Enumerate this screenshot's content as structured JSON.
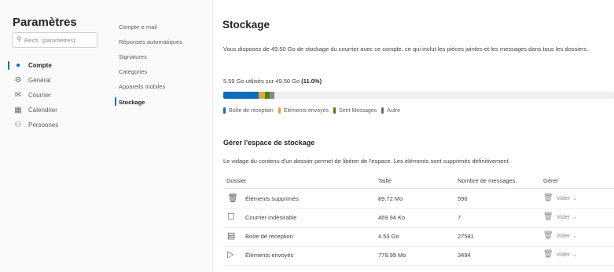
{
  "settings": {
    "title": "Paramètres",
    "search_placeholder": "Rech. (paramètres)"
  },
  "nav_primary": [
    {
      "label": "Compte",
      "icon": "person-icon",
      "active": true
    },
    {
      "label": "Général",
      "icon": "gear-icon",
      "active": false
    },
    {
      "label": "Courrier",
      "icon": "mail-icon",
      "active": false
    },
    {
      "label": "Calendrier",
      "icon": "calendar-icon",
      "active": false
    },
    {
      "label": "Personnes",
      "icon": "people-icon",
      "active": false
    }
  ],
  "nav_secondary": [
    {
      "label": "Compte e-mail",
      "active": false
    },
    {
      "label": "Réponses automatiques",
      "active": false
    },
    {
      "label": "Signatures",
      "active": false
    },
    {
      "label": "Catégories",
      "active": false
    },
    {
      "label": "Appareils mobiles",
      "active": false
    },
    {
      "label": "Stockage",
      "active": true
    }
  ],
  "main": {
    "title": "Stockage",
    "description": "Vous disposez de 49.50 Go de stockage du courrier avec ce compte, ce qui inclut les pièces jointes et les messages dans tous les dossiers.",
    "usage_text": "5.59 Go utilisés sur 49.50 Go",
    "usage_percent_text": "(11.0%)",
    "bar": [
      {
        "name": "Boîte de réception",
        "fraction": 0.0915,
        "color": "#0f6cbd"
      },
      {
        "name": "Éléments envoyés",
        "fraction": 0.0154,
        "color": "#e8a33a"
      },
      {
        "name": "Sent Messages",
        "fraction": 0.0109,
        "color": "#498205"
      },
      {
        "name": "Autre",
        "fraction": 0.0122,
        "color": "#8a8886"
      }
    ],
    "legend": [
      {
        "label": "Boîte de réception",
        "color": "#0f6cbd"
      },
      {
        "label": "Éléments envoyés",
        "color": "#e8a33a"
      },
      {
        "label": "Sent Messages",
        "color": "#498205"
      },
      {
        "label": "Autre",
        "color": "#6b6b6b"
      }
    ],
    "manage_title": "Gérer l'espace de stockage",
    "manage_desc": "Le vidage du contenu d'un dossier permet de libérer de l'espace. Les éléments sont supprimés définitivement.",
    "table": {
      "headers": [
        "Dossier",
        "Taille",
        "Nombre de messages",
        "Gérer"
      ],
      "rows": [
        {
          "folder": "Éléments supprimés",
          "size": "89.72 Mo",
          "count": "596",
          "action": "Vider",
          "icon": "trash-icon"
        },
        {
          "folder": "Courrier indésirable",
          "size": "469.94 Ko",
          "count": "7",
          "action": "Vider",
          "icon": "junk-icon"
        },
        {
          "folder": "Boîte de réception",
          "size": "4.53 Go",
          "count": "27581",
          "action": "Vider",
          "icon": "inbox-icon"
        },
        {
          "folder": "Éléments envoyés",
          "size": "778.99 Mo",
          "count": "3494",
          "action": "Vider",
          "icon": "send-icon"
        }
      ]
    }
  }
}
